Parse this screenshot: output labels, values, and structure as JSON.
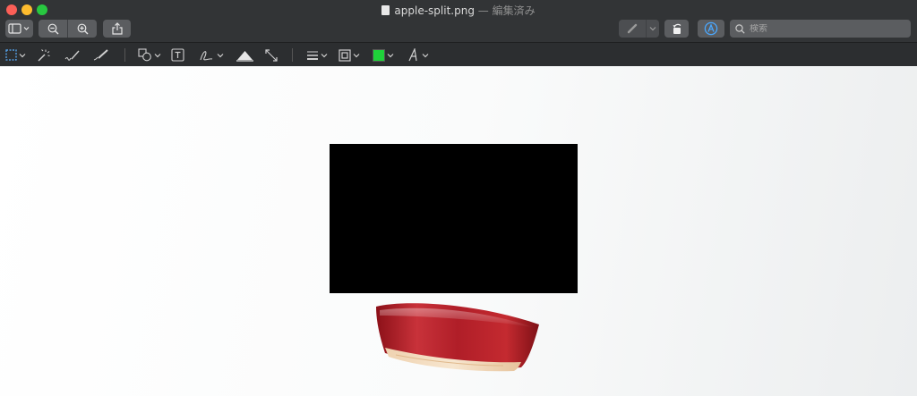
{
  "window": {
    "filename": "apple-split.png",
    "edited_suffix": " — 編集済み"
  },
  "toolbar": {
    "search_placeholder": "検索",
    "buttons": [
      "sidebar-toggle",
      "zoom-out",
      "zoom-in",
      "share",
      "highlight",
      "rotate",
      "markup"
    ]
  },
  "markup_toolbar": {
    "tools": [
      "rectangular-selection",
      "instant-alpha",
      "sketch",
      "draw",
      "shapes",
      "text",
      "sign",
      "adjust-color",
      "adjust-size",
      "shape-style",
      "border-color",
      "fill-color",
      "text-style"
    ],
    "fill_color": "#1fd13a"
  },
  "colors": {
    "titlebar": "#323436",
    "markup_bar": "#2c2e30",
    "redaction_box": "#000000",
    "apple_skin": "#b8202a"
  }
}
